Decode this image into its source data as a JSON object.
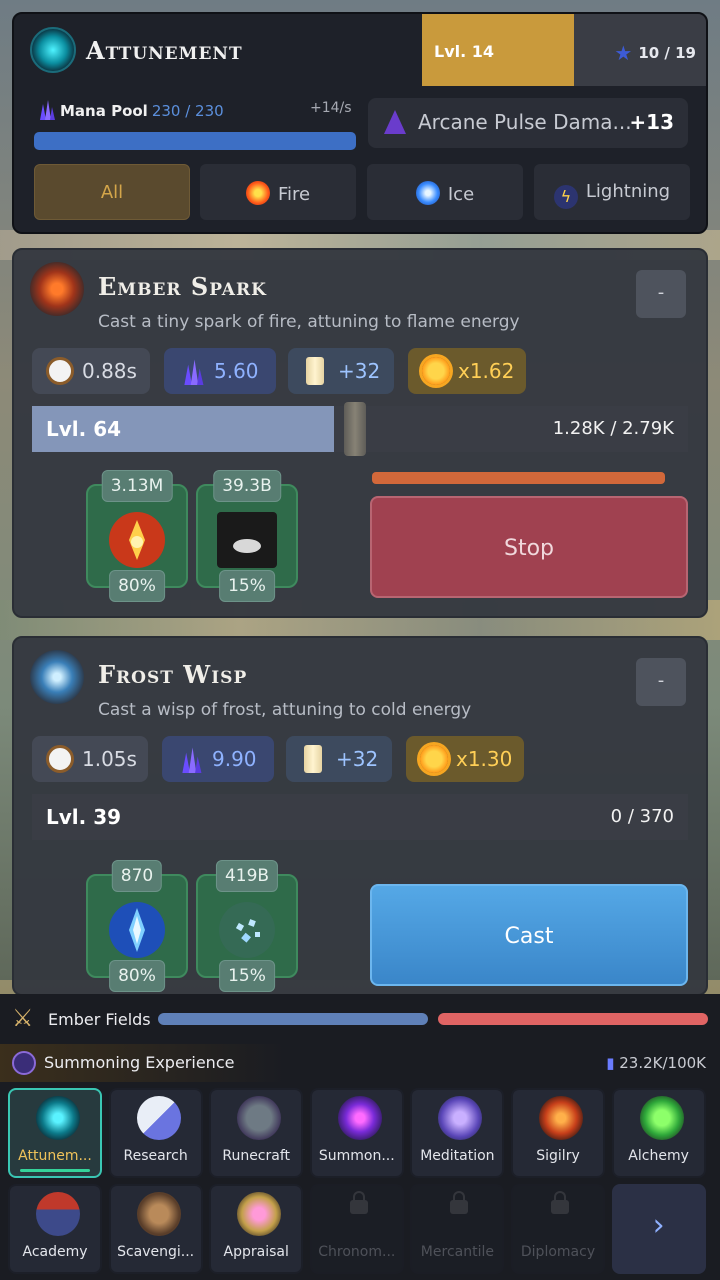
{
  "header": {
    "title": "Attunement",
    "level": "Lvl. 14",
    "points": "10 / 19",
    "mana": {
      "label": "Mana Pool",
      "value": "230 / 230",
      "rate": "+14/s",
      "fill": 1.0
    },
    "pulse": {
      "label": "Arcane Pulse Dama...",
      "bonus": "+13"
    },
    "filters": [
      {
        "label": "All",
        "active": true
      },
      {
        "label": "Fire",
        "icon": "fire-orb-icon",
        "color": "#ff5a1a"
      },
      {
        "label": "Ice",
        "icon": "ice-orb-icon",
        "color": "#3a8cff"
      },
      {
        "label": "Lightning",
        "icon": "lightning-icon",
        "color": "#ffd34a"
      }
    ]
  },
  "spells": [
    {
      "name": "Ember Spark",
      "description": "Cast a tiny spark of fire, attuning to flame energy",
      "collapse": "-",
      "stats": {
        "time": "0.88s",
        "mana": "5.60",
        "xp": "+32",
        "mult": "x1.62"
      },
      "level": "Lvl. 64",
      "xp_text": "1.28K / 2.79K",
      "xp_fill": 0.46,
      "items": [
        {
          "amount": "3.13M",
          "chance": "80%",
          "icon": "fire-crystal-icon"
        },
        {
          "amount": "39.3B",
          "chance": "15%",
          "icon": "ash-pile-icon"
        }
      ],
      "action": "Stop",
      "cast_progress": 0.92
    },
    {
      "name": "Frost Wisp",
      "description": "Cast a wisp of frost, attuning to cold energy",
      "collapse": "-",
      "stats": {
        "time": "1.05s",
        "mana": "9.90",
        "xp": "+32",
        "mult": "x1.30"
      },
      "level": "Lvl. 39",
      "xp_text": "0 / 370",
      "xp_fill": 0,
      "items": [
        {
          "amount": "870",
          "chance": "80%",
          "icon": "ice-crystal-icon"
        },
        {
          "amount": "419B",
          "chance": "15%",
          "icon": "frost-shards-icon"
        }
      ],
      "action": "Cast"
    }
  ],
  "bottom": {
    "zone": "Ember Fields",
    "experience_label": "Summoning Experience",
    "experience_value": "23.2K/100K",
    "nav": [
      {
        "label": "Attunem...",
        "icon": "attunement-icon",
        "active": true
      },
      {
        "label": "Research",
        "icon": "book-magnifier-icon"
      },
      {
        "label": "Runecraft",
        "icon": "rune-stone-icon"
      },
      {
        "label": "Summon...",
        "icon": "summoning-circle-icon"
      },
      {
        "label": "Meditation",
        "icon": "meditation-icon"
      },
      {
        "label": "Sigilry",
        "icon": "sigil-icon"
      },
      {
        "label": "Alchemy",
        "icon": "potion-flask-icon"
      },
      {
        "label": "Academy",
        "icon": "academy-building-icon"
      },
      {
        "label": "Scavengi...",
        "icon": "cauldron-icon"
      },
      {
        "label": "Appraisal",
        "icon": "gem-magnifier-icon"
      },
      {
        "label": "Chronom...",
        "icon": "lock-icon",
        "locked": true
      },
      {
        "label": "Mercantile",
        "icon": "lock-icon",
        "locked": true
      },
      {
        "label": "Diplomacy",
        "icon": "lock-icon",
        "locked": true
      }
    ],
    "next": "›"
  }
}
